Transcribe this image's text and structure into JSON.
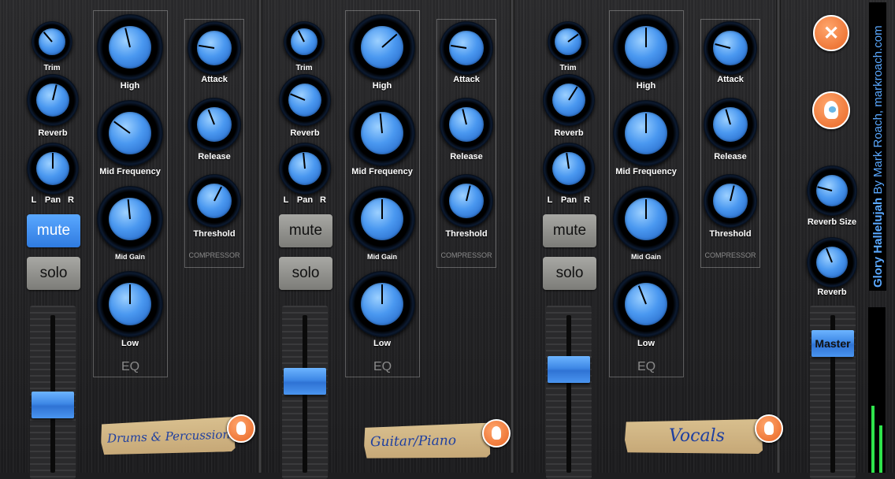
{
  "channels": [
    {
      "name": "Drums & Percussion",
      "trim_label": "Trim",
      "reverb_label": "Reverb",
      "pan": {
        "left": "L",
        "label": "Pan",
        "right": "R"
      },
      "mute_label": "mute",
      "solo_label": "solo",
      "mute_active": true,
      "eq": {
        "title": "EQ",
        "high": "High",
        "mid_frequency": "Mid Frequency",
        "mid_gain": "Mid Gain",
        "low": "Low"
      },
      "compressor": {
        "title": "COMPRESSOR",
        "attack": "Attack",
        "release": "Release",
        "threshold": "Threshold"
      },
      "fader_level": 0.48,
      "knob_values": {
        "trim": 0.35,
        "reverb": 0.55,
        "pan": 0.5,
        "high": 0.45,
        "mid_frequency": 0.3,
        "mid_gain": 0.48,
        "low": 0.5,
        "attack": 0.2,
        "release": 0.42,
        "threshold": 0.6
      }
    },
    {
      "name": "Guitar/Piano",
      "trim_label": "Trim",
      "reverb_label": "Reverb",
      "pan": {
        "left": "L",
        "label": "Pan",
        "right": "R"
      },
      "mute_label": "mute",
      "solo_label": "solo",
      "mute_active": false,
      "eq": {
        "title": "EQ",
        "high": "High",
        "mid_frequency": "Mid Frequency",
        "mid_gain": "Mid Gain",
        "low": "Low"
      },
      "compressor": {
        "title": "COMPRESSOR",
        "attack": "Attack",
        "release": "Release",
        "threshold": "Threshold"
      },
      "fader_level": 0.64,
      "knob_values": {
        "trim": 0.4,
        "reverb": 0.25,
        "pan": 0.48,
        "high": 0.68,
        "mid_frequency": 0.48,
        "mid_gain": 0.5,
        "low": 0.5,
        "attack": 0.2,
        "release": 0.45,
        "threshold": 0.55
      }
    },
    {
      "name": "Vocals",
      "trim_label": "Trim",
      "reverb_label": "Reverb",
      "pan": {
        "left": "L",
        "label": "Pan",
        "right": "R"
      },
      "mute_label": "mute",
      "solo_label": "solo",
      "mute_active": false,
      "eq": {
        "title": "EQ",
        "high": "High",
        "mid_frequency": "Mid Frequency",
        "mid_gain": "Mid Gain",
        "low": "Low"
      },
      "compressor": {
        "title": "COMPRESSOR",
        "attack": "Attack",
        "release": "Release",
        "threshold": "Threshold"
      },
      "fader_level": 0.72,
      "knob_values": {
        "trim": 0.7,
        "reverb": 0.62,
        "pan": 0.47,
        "high": 0.5,
        "mid_frequency": 0.5,
        "mid_gain": 0.5,
        "low": 0.42,
        "attack": 0.22,
        "release": 0.44,
        "threshold": 0.55
      }
    }
  ],
  "master": {
    "reverb_size_label": "Reverb Size",
    "reverb_label": "Reverb",
    "fader_label": "Master",
    "knob_values": {
      "reverb_size": 0.22,
      "reverb": 0.42
    },
    "fader_level": 0.9
  },
  "song_title": "Glory Hallelujah",
  "song_credit": "By Mark Roach, markroach.com",
  "colors": {
    "accent": "#3e88e6",
    "orange": "#e86524",
    "meter_green": "#2fe34c"
  },
  "icons": {
    "close": "close-icon",
    "help": "head-help-icon"
  }
}
